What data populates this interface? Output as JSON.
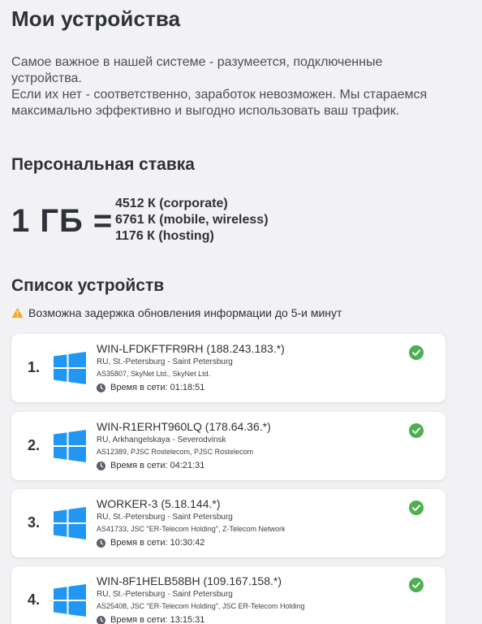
{
  "page_title": "Мои устройства",
  "intro": {
    "line1": "Самое важное в нашей системе - разумеется, подключенные устройства.",
    "line2": "Если их нет - соответственно, заработок невозможен. Мы стараемся максимально эффективно и выгодно использовать ваш трафик."
  },
  "rate": {
    "heading": "Персональная ставка",
    "big_label": "1 ГБ =",
    "lines": [
      "4512 К (corporate)",
      "6761 К (mobile, wireless)",
      "1176 К (hosting)"
    ]
  },
  "devices": {
    "heading": "Список устройств",
    "warning": "Возможна задержка обновления информации до 5-и минут",
    "uptime_label": "Время в сети:",
    "items": [
      {
        "num": "1.",
        "title": "WIN-LFDKFTFR9RH (188.243.183.*)",
        "location": "RU, St.-Petersburg - Saint Petersburg",
        "as": "AS35807, SkyNet Ltd., SkyNet Ltd.",
        "uptime": "Время в сети: 01:18:51"
      },
      {
        "num": "2.",
        "title": "WIN-R1ERHT960LQ (178.64.36.*)",
        "location": "RU, Arkhangelskaya - Severodvinsk",
        "as": "AS12389, PJSC Rostelecom, PJSC Rostelecom",
        "uptime": "Время в сети: 04:21:31"
      },
      {
        "num": "3.",
        "title": "WORKER-3 (5.18.144.*)",
        "location": "RU, St.-Petersburg - Saint Petersburg",
        "as": "AS41733, JSC \"ER-Telecom Holding\", Z-Telecom Network",
        "uptime": "Время в сети: 10:30:42"
      },
      {
        "num": "4.",
        "title": "WIN-8F1HELB58BH (109.167.158.*)",
        "location": "RU, St.-Petersburg - Saint Petersburg",
        "as": "AS25408, JSC \"ER-Telecom Holding\", JSC ER-Telecom Holding",
        "uptime": "Время в сети: 13:15:31"
      }
    ]
  },
  "colors": {
    "windows_blue": "#2196f3",
    "status_green": "#4caf50",
    "warning_orange": "#f5a623"
  },
  "icons": {
    "device": "windows-logo-icon",
    "status": "check-circle-icon",
    "uptime": "clock-icon",
    "warning": "warning-triangle-icon"
  }
}
